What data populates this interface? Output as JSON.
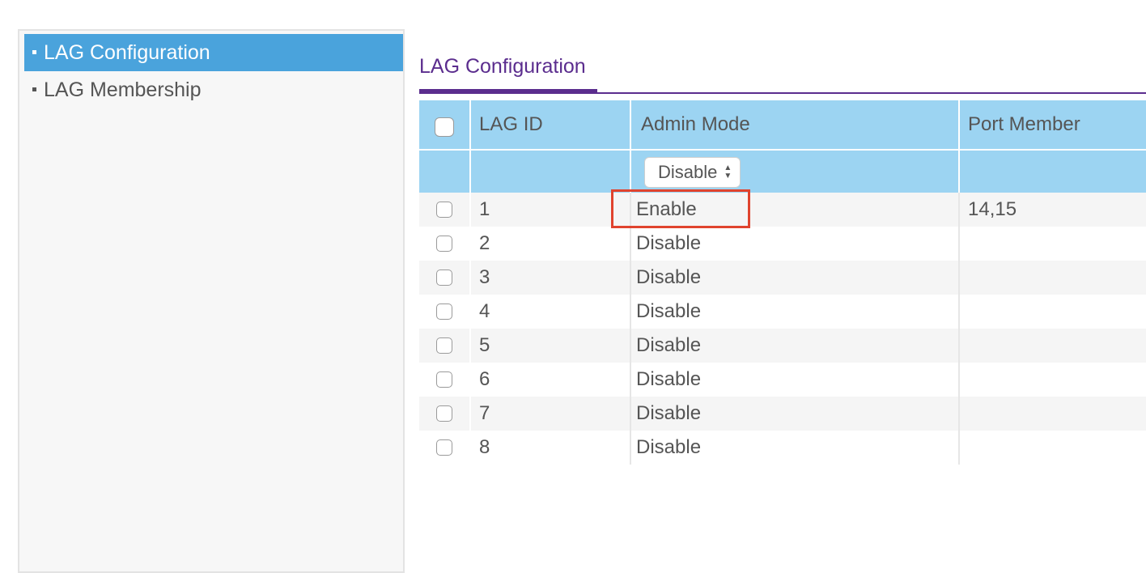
{
  "sidebar": {
    "items": [
      {
        "label": "LAG Configuration",
        "active": true
      },
      {
        "label": "LAG Membership",
        "active": false
      }
    ]
  },
  "main": {
    "title": "LAG Configuration",
    "accent_color": "#5b2d8e"
  },
  "table": {
    "headers": {
      "lag_id": "LAG ID",
      "admin_mode": "Admin Mode",
      "port_member": "Port Member"
    },
    "filter": {
      "admin_mode_selected": "Disable"
    },
    "rows": [
      {
        "lag_id": "1",
        "admin_mode": "Enable",
        "port_member": "14,15"
      },
      {
        "lag_id": "2",
        "admin_mode": "Disable",
        "port_member": ""
      },
      {
        "lag_id": "3",
        "admin_mode": "Disable",
        "port_member": ""
      },
      {
        "lag_id": "4",
        "admin_mode": "Disable",
        "port_member": ""
      },
      {
        "lag_id": "5",
        "admin_mode": "Disable",
        "port_member": ""
      },
      {
        "lag_id": "6",
        "admin_mode": "Disable",
        "port_member": ""
      },
      {
        "lag_id": "7",
        "admin_mode": "Disable",
        "port_member": ""
      },
      {
        "lag_id": "8",
        "admin_mode": "Disable",
        "port_member": ""
      }
    ]
  },
  "colors": {
    "sidebar_active": "#4aa3dc",
    "table_header": "#9cd4f2",
    "highlight": "#e0432e"
  }
}
